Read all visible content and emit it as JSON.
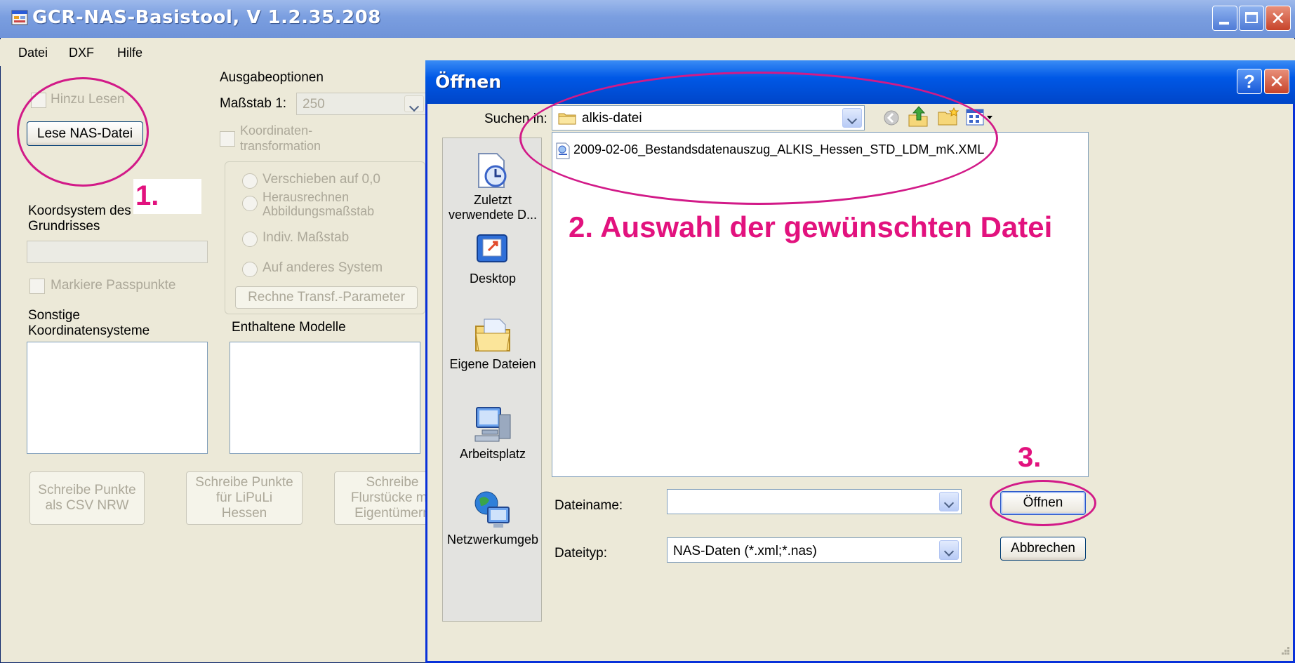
{
  "main_window": {
    "title": "GCR-NAS-Basistool, V 1.2.35.208",
    "menu": [
      "Datei",
      "DXF",
      "Hilfe"
    ],
    "ausgabe_label": "Ausgabeoptionen",
    "massstab_label": "Maßstab 1:",
    "massstab_value": "250",
    "hinzu_lesen": "Hinzu Lesen",
    "lese_button": "Lese NAS-Datei",
    "koordinaten_line1": "Koordinaten-",
    "koordinaten_line2": "transformation",
    "radio_verschieben": "Verschieben auf 0,0",
    "radio_heraus_line1": "Herausrechnen",
    "radio_heraus_line2": "Abbildungsmaßstab",
    "radio_indiv": "Indiv. Maßstab",
    "radio_auf": "Auf anderes System",
    "rechne_button": "Rechne Transf.-Parameter",
    "koord_line1": "Koordsystem des",
    "koord_line2": "Grundrisses",
    "koord_value": "",
    "markiere": "Markiere Passpunkte",
    "sonstige_line1": "Sonstige",
    "sonstige_line2": "Koordinatensysteme",
    "enthaltene": "Enthaltene Modelle",
    "btn_csv_line1": "Schreibe Punkte",
    "btn_csv_line2": "als CSV NRW",
    "btn_lipuli_line1": "Schreibe Punkte",
    "btn_lipuli_line2": "für LiPuLi",
    "btn_lipuli_line3": "Hessen",
    "btn_flur_line1": "Schreibe",
    "btn_flur_line2": "Flurstücke mit",
    "btn_flur_line3": "Eigentümern"
  },
  "dialog": {
    "title": "Öffnen",
    "help_glyph": "?",
    "close_glyph": "✕",
    "suchen_label": "Suchen in:",
    "suchen_value": "alkis-datei",
    "places": [
      {
        "line1": "Zuletzt",
        "line2": "verwendete D...",
        "icon": "recent-icon"
      },
      {
        "line1": "Desktop",
        "line2": "",
        "icon": "desktop-icon"
      },
      {
        "line1": "Eigene Dateien",
        "line2": "",
        "icon": "my-documents-icon"
      },
      {
        "line1": "Arbeitsplatz",
        "line2": "",
        "icon": "my-computer-icon"
      },
      {
        "line1": "Netzwerkumgeb",
        "line2": "",
        "icon": "network-icon"
      }
    ],
    "files": [
      {
        "name": "2009-02-06_Bestandsdatenauszug_ALKIS_Hessen_STD_LDM_mK.XML",
        "icon": "xml-file-icon"
      }
    ],
    "dateiname_label": "Dateiname:",
    "dateiname_value": "",
    "dateityp_label": "Dateityp:",
    "dateityp_value": "NAS-Daten (*.xml;*.nas)",
    "open_button": "Öffnen",
    "cancel_button": "Abbrechen"
  },
  "annotations": {
    "step1": "1.",
    "step2": "2. Auswahl der gewünschten Datei",
    "step3": "3.",
    "color": "#e2127e"
  }
}
